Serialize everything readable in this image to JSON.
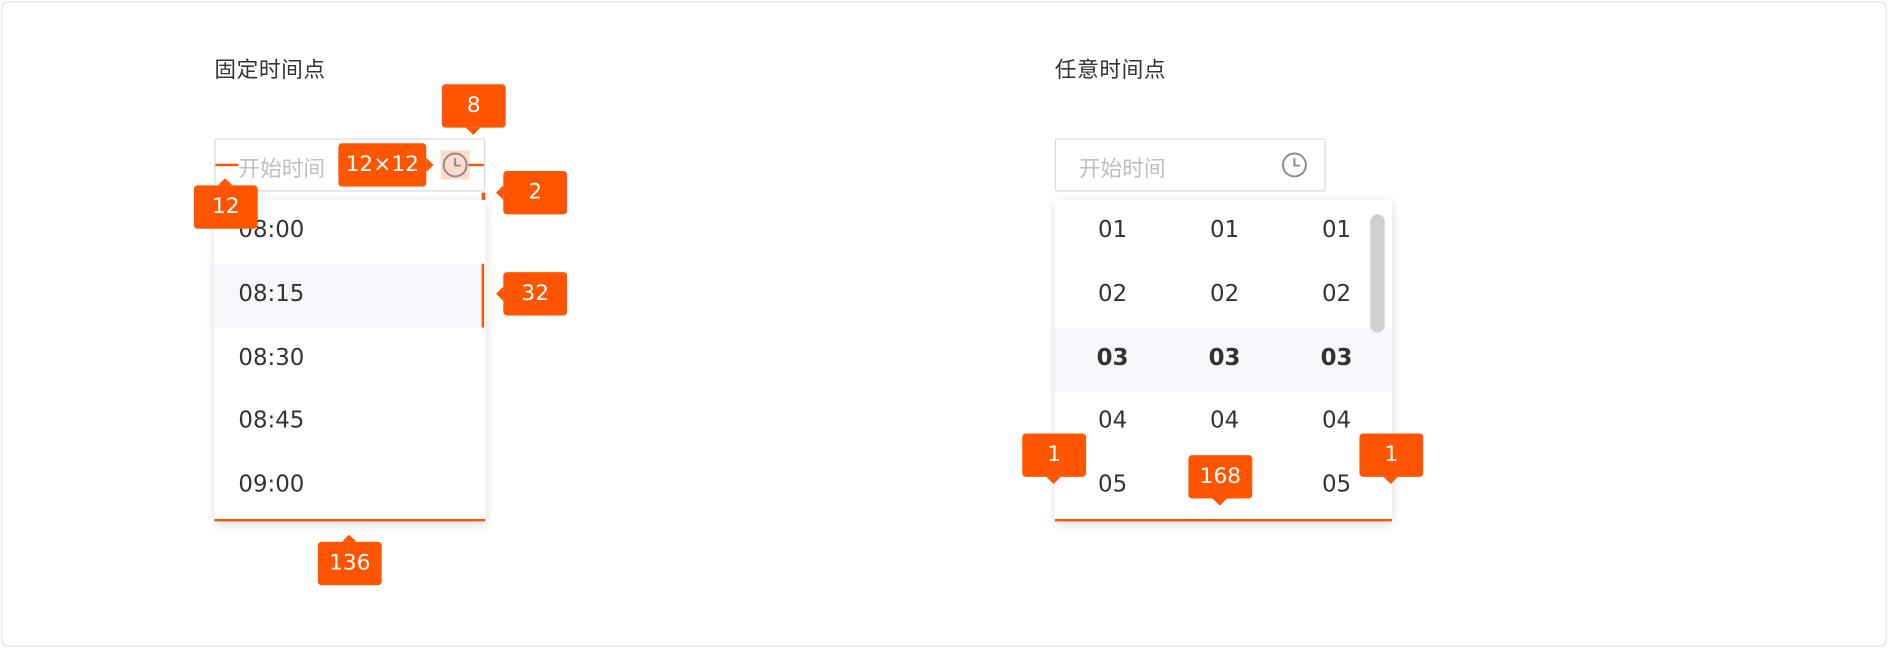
{
  "fixed": {
    "title": "固定时间点",
    "placeholder": "开始时间",
    "options": [
      "08:00",
      "08:15",
      "08:30",
      "08:45",
      "09:00"
    ],
    "hovered_option": "08:15"
  },
  "any": {
    "title": "任意时间点",
    "placeholder": "开始时间",
    "columns": [
      [
        "01",
        "02",
        "03",
        "04",
        "05"
      ],
      [
        "01",
        "02",
        "03",
        "04",
        "05"
      ],
      [
        "01",
        "02",
        "03",
        "04",
        "05"
      ]
    ],
    "selected": "03"
  },
  "annotations": {
    "icon_gap": "8",
    "icon_size": "12×12",
    "padding_left": "12",
    "dropdown_gap": "2",
    "option_height": "32",
    "fixed_width": "136",
    "any_left": "1",
    "any_width": "168",
    "any_right": "1"
  },
  "colors": {
    "accent": "#ff5500",
    "hover_bg": "#f5f7fa",
    "placeholder": "#bfbfbf",
    "text": "#333333"
  },
  "icons": {
    "clock": "clock-icon"
  }
}
